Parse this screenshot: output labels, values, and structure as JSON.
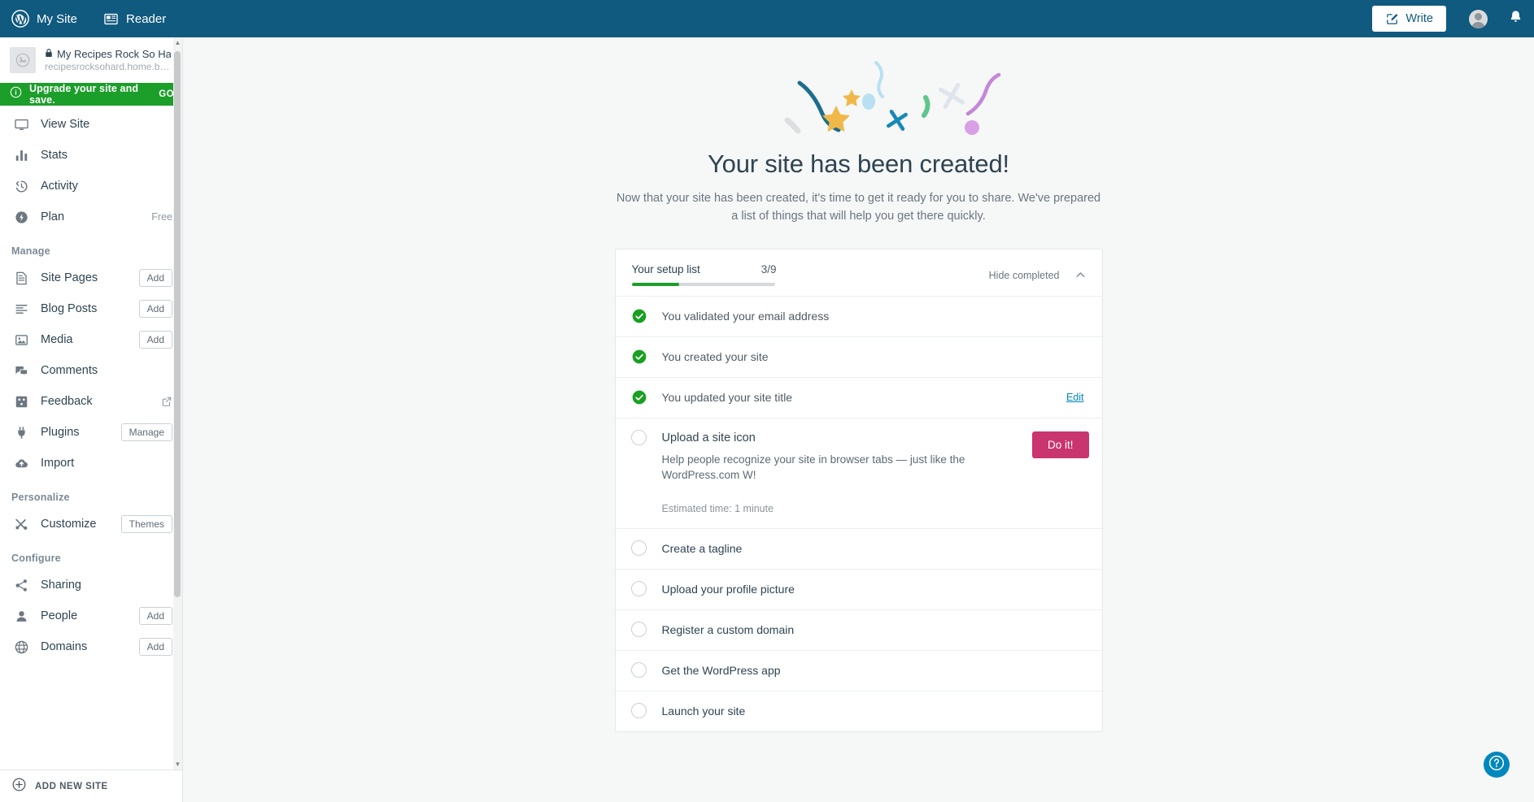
{
  "masterbar": {
    "my_site_label": "My Site",
    "reader_label": "Reader",
    "write_label": "Write",
    "wordpress_icon": "wordpress-logo-icon",
    "reader_icon": "reader-icon",
    "write_icon": "write-pencil-icon",
    "avatar_icon": "user-avatar-icon",
    "notifications_icon": "notifications-bell-icon",
    "brand_color": "#10597f"
  },
  "sidebar": {
    "site": {
      "title": "My Recipes Rock So Hard",
      "url": "recipesrocksohard.home.blog",
      "lock_icon": "lock-icon",
      "thumb_icon": "site-placeholder-icon"
    },
    "upgrade_banner": {
      "label": "Upgrade your site and save.",
      "action": "GO",
      "icon": "info-circle-icon",
      "color": "#1c9e2b"
    },
    "items": [
      {
        "label": "View Site",
        "icon": "monitor-icon",
        "tag": "",
        "button": "",
        "external": false
      },
      {
        "label": "Stats",
        "icon": "bar-chart-icon",
        "tag": "",
        "button": "",
        "external": false
      },
      {
        "label": "Activity",
        "icon": "clock-history-icon",
        "tag": "",
        "button": "",
        "external": false
      },
      {
        "label": "Plan",
        "icon": "plan-badge-icon",
        "tag": "Free",
        "button": "",
        "external": false
      }
    ],
    "sections": [
      {
        "title": "Manage",
        "items": [
          {
            "label": "Site Pages",
            "icon": "pages-icon",
            "tag": "",
            "button": "Add",
            "external": false
          },
          {
            "label": "Blog Posts",
            "icon": "posts-icon",
            "tag": "",
            "button": "Add",
            "external": false
          },
          {
            "label": "Media",
            "icon": "media-image-icon",
            "tag": "",
            "button": "Add",
            "external": false
          },
          {
            "label": "Comments",
            "icon": "comments-icon",
            "tag": "",
            "button": "",
            "external": false
          },
          {
            "label": "Feedback",
            "icon": "feedback-icon",
            "tag": "",
            "button": "",
            "external": true
          },
          {
            "label": "Plugins",
            "icon": "plugins-plug-icon",
            "tag": "",
            "button": "Manage",
            "external": false
          },
          {
            "label": "Import",
            "icon": "import-cloud-icon",
            "tag": "",
            "button": "",
            "external": false
          }
        ]
      },
      {
        "title": "Personalize",
        "items": [
          {
            "label": "Customize",
            "icon": "customize-tools-icon",
            "tag": "",
            "button": "Themes",
            "external": false
          }
        ]
      },
      {
        "title": "Configure",
        "items": [
          {
            "label": "Sharing",
            "icon": "share-icon",
            "tag": "",
            "button": "",
            "external": false
          },
          {
            "label": "People",
            "icon": "person-icon",
            "tag": "",
            "button": "Add",
            "external": false
          },
          {
            "label": "Domains",
            "icon": "globe-icon",
            "tag": "",
            "button": "Add",
            "external": false
          }
        ]
      }
    ],
    "add_new_site": {
      "label": "ADD NEW SITE",
      "icon": "plus-circle-icon"
    }
  },
  "hero": {
    "title": "Your site has been created!",
    "subtitle": "Now that your site has been created, it's time to get it ready for you to share. We've prepared a list of things that will help you get there quickly.",
    "illustration": "confetti-celebration-illustration"
  },
  "setup_card": {
    "header": {
      "title": "Your setup list",
      "count": "3/9",
      "completed": 3,
      "total": 9,
      "progress_percent": 33,
      "hide_completed_label": "Hide completed",
      "collapse_icon": "chevron-up-icon"
    },
    "tasks": [
      {
        "title": "You validated your email address",
        "completed": true,
        "icon": "check-circle-icon",
        "description": "",
        "estimated_time": "",
        "action_label": "",
        "edit_label": "",
        "expanded": false
      },
      {
        "title": "You created your site",
        "completed": true,
        "icon": "check-circle-icon",
        "description": "",
        "estimated_time": "",
        "action_label": "",
        "edit_label": "",
        "expanded": false
      },
      {
        "title": "You updated your site title",
        "completed": true,
        "icon": "check-circle-icon",
        "description": "",
        "estimated_time": "",
        "action_label": "",
        "edit_label": "Edit",
        "expanded": false
      },
      {
        "title": "Upload a site icon",
        "completed": false,
        "icon": "empty-circle-icon",
        "description": "Help people recognize your site in browser tabs — just like the WordPress.com W!",
        "estimated_time": "Estimated time: 1 minute",
        "action_label": "Do it!",
        "edit_label": "",
        "expanded": true
      },
      {
        "title": "Create a tagline",
        "completed": false,
        "icon": "empty-circle-icon",
        "description": "",
        "estimated_time": "",
        "action_label": "",
        "edit_label": "",
        "expanded": false
      },
      {
        "title": "Upload your profile picture",
        "completed": false,
        "icon": "empty-circle-icon",
        "description": "",
        "estimated_time": "",
        "action_label": "",
        "edit_label": "",
        "expanded": false
      },
      {
        "title": "Register a custom domain",
        "completed": false,
        "icon": "empty-circle-icon",
        "description": "",
        "estimated_time": "",
        "action_label": "",
        "edit_label": "",
        "expanded": false
      },
      {
        "title": "Get the WordPress app",
        "completed": false,
        "icon": "empty-circle-icon",
        "description": "",
        "estimated_time": "",
        "action_label": "",
        "edit_label": "",
        "expanded": false
      },
      {
        "title": "Launch your site",
        "completed": false,
        "icon": "empty-circle-icon",
        "description": "",
        "estimated_time": "",
        "action_label": "",
        "edit_label": "",
        "expanded": false
      }
    ]
  },
  "help": {
    "icon": "help-question-icon",
    "color": "#0087be"
  },
  "colors": {
    "masterbar": "#10597f",
    "green": "#1c9e2b",
    "pink": "#c9356e",
    "link_blue": "#0087be",
    "page_bg": "#f6f7f7"
  }
}
